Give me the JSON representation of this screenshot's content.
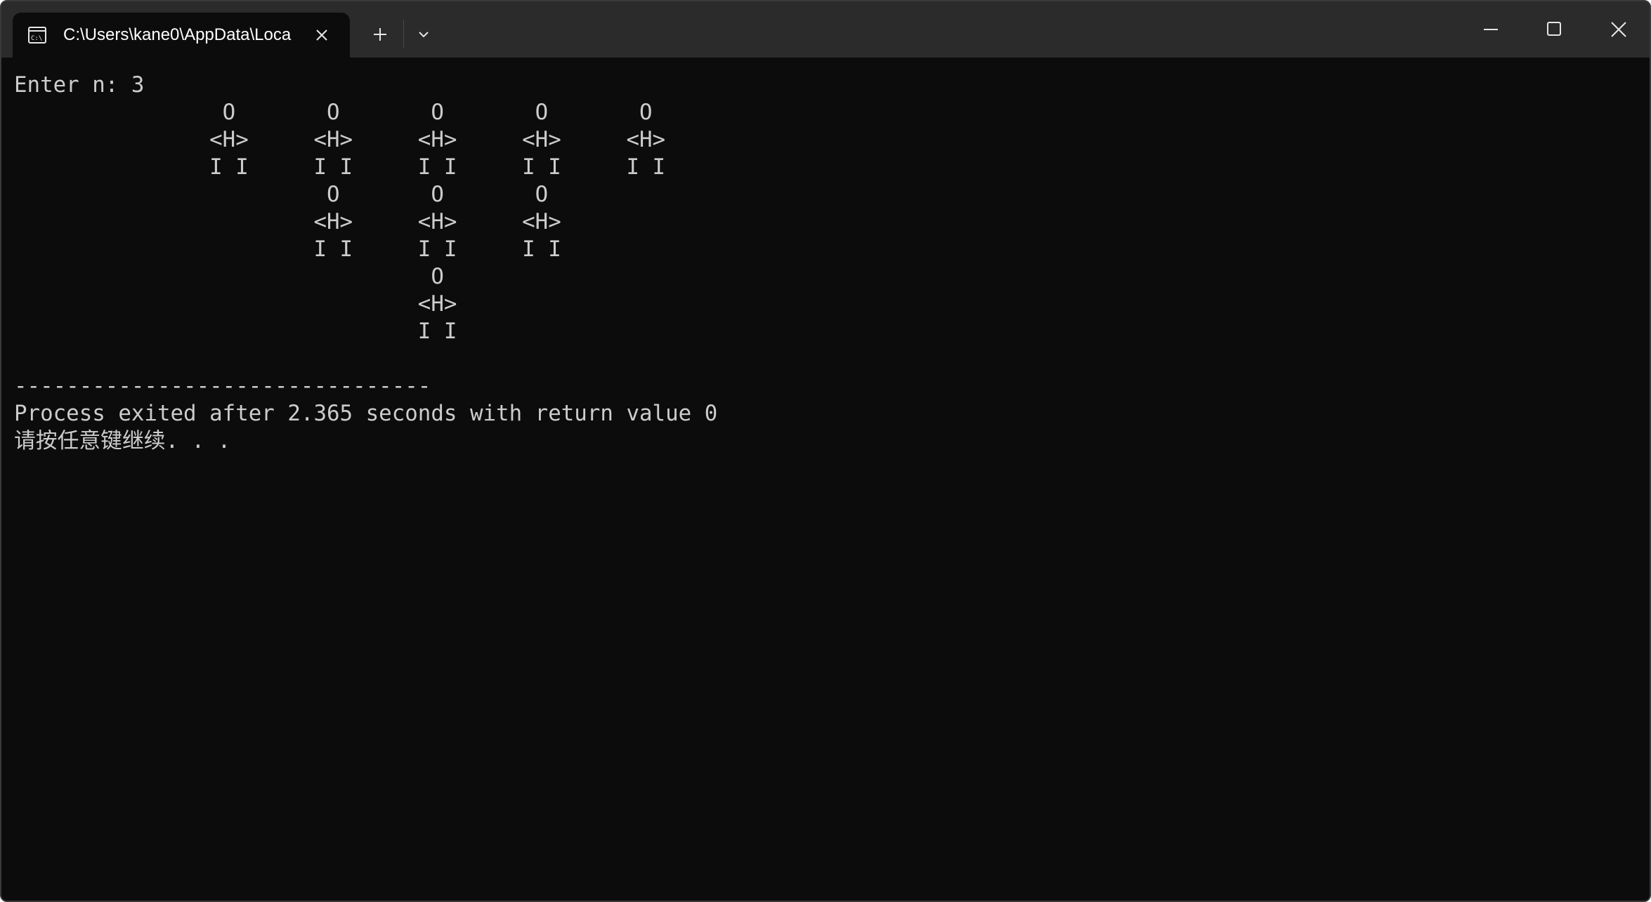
{
  "window": {
    "tab_title": "C:\\Users\\kane0\\AppData\\Loca",
    "tab_icon": "console-icon",
    "colors": {
      "titlebar": "#2b2b2b",
      "terminal_background": "#0c0c0c",
      "terminal_text": "#cccccc"
    }
  },
  "console": {
    "lines": [
      "Enter n: 3",
      "                O       O       O       O       O",
      "               <H>     <H>     <H>     <H>     <H>",
      "               I I     I I     I I     I I     I I",
      "                        O       O       O",
      "                       <H>     <H>     <H>",
      "                       I I     I I     I I",
      "                                O",
      "                               <H>",
      "                               I I",
      "",
      "--------------------------------",
      "Process exited after 2.365 seconds with return value 0",
      "请按任意键继续. . ."
    ]
  }
}
